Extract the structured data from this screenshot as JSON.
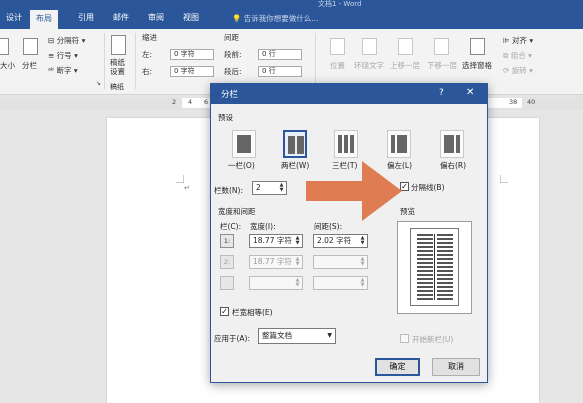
{
  "window": {
    "title": "文档1 - Word"
  },
  "tabs": [
    {
      "label": "设计",
      "active": false
    },
    {
      "label": "布局",
      "active": true
    },
    {
      "label": "引用",
      "active": false
    },
    {
      "label": "邮件",
      "active": false
    },
    {
      "label": "审阅",
      "active": false
    },
    {
      "label": "视图",
      "active": false
    }
  ],
  "tellme": "告诉我你想要做什么...",
  "ribbon": {
    "size_label": "大小",
    "columns_label": "分栏",
    "breaks_label": "分隔符",
    "line_numbers_label": "行号",
    "hyphenation_label": "断字",
    "draft_paper_label": "稿纸",
    "draft_paper_setting_label": "稿纸设置",
    "draft_paper_group": "稿纸",
    "indent_header": "缩进",
    "spacing_header": "间距",
    "indent_left_label": "左:",
    "indent_left_value": "0 字符",
    "indent_right_label": "右:",
    "indent_right_value": "0 字符",
    "spacing_before_label": "段前:",
    "spacing_before_value": "0 行",
    "spacing_after_label": "段后:",
    "spacing_after_value": "0 行",
    "position_label": "位置",
    "wrap_label": "环绕文字",
    "bring_forward_label": "上移一层",
    "send_backward_label": "下移一层",
    "selection_pane_label": "选择窗格",
    "align_label": "对齐",
    "group_label": "组合",
    "rotate_label": "旋转"
  },
  "ruler": {
    "left_numbers": [
      "2",
      "4",
      "6"
    ],
    "right_numbers": [
      "38",
      "40"
    ]
  },
  "dialog": {
    "title": "分栏",
    "help_label": "?",
    "close_label": "✕",
    "preset_header": "预设",
    "presets": [
      {
        "label": "一栏(O)",
        "columns": 1,
        "selected": false
      },
      {
        "label": "两栏(W)",
        "columns": 2,
        "selected": true
      },
      {
        "label": "三栏(T)",
        "columns": 3,
        "selected": false
      },
      {
        "label": "偏左(L)",
        "columns": 2,
        "selected": false
      },
      {
        "label": "偏右(R)",
        "columns": 2,
        "selected": false
      }
    ],
    "num_columns_label": "栏数(N):",
    "num_columns_value": "2",
    "divider_label": "分隔线(B)",
    "divider_checked": true,
    "width_spacing_header": "宽度和间距",
    "col_header": "栏(C):",
    "width_header": "宽度(I):",
    "spacing_header": "间距(S):",
    "rows": [
      {
        "col": "1:",
        "width": "18.77 字符",
        "spacing": "2.02 字符",
        "enabled": true
      },
      {
        "col": "2:",
        "width": "18.77 字符",
        "spacing": "",
        "enabled": false
      },
      {
        "col": "",
        "width": "",
        "spacing": "",
        "enabled": false
      }
    ],
    "equal_width_label": "栏宽相等(E)",
    "equal_width_checked": true,
    "preview_header": "预览",
    "apply_to_label": "应用于(A):",
    "apply_to_value": "整篇文档",
    "new_column_label": "开始新栏(U)",
    "new_column_checked": false,
    "ok_label": "确定",
    "cancel_label": "取消"
  },
  "colors": {
    "accent": "#2b579a",
    "arrow": "#e07c52"
  }
}
